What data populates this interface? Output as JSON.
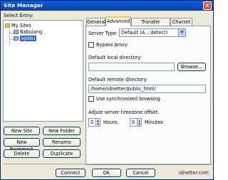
{
  "window": {
    "title": "Site Manager",
    "close_glyph": "×"
  },
  "left": {
    "select_entry_label": "Select Entry:",
    "tree": [
      {
        "label": "My Sites",
        "icon": "folder-icon"
      },
      {
        "label": "Babulang",
        "icon": "site-icon"
      },
      {
        "label": "vpsku",
        "icon": "site-icon",
        "selected": true
      }
    ],
    "buttons": {
      "new_site": "New Site",
      "new_folder": "New Folder",
      "new_bookmark": "New Bookmark",
      "rename": "Rename",
      "delete": "Delete",
      "duplicate": "Duplicate"
    }
  },
  "tabs": [
    "General",
    "Advanced",
    "Transfer Settings",
    "Charset"
  ],
  "active_tab": "Advanced",
  "advanced": {
    "server_type_label": "Server Type:",
    "server_type_value": "Default (A....detect)",
    "bypass_proxy_label": "Bypass proxy",
    "default_local_dir_label": "Default local directory:",
    "default_local_dir_value": "",
    "browse_label": "Browse...",
    "default_remote_dir_label": "Default remote directory:",
    "default_remote_dir_value": "/home/idnetter/public_html/",
    "sync_browsing_label": "Use synchronized browsing",
    "timezone_label": "Adjust server timezone offset:",
    "hours_value": "0",
    "hours_label": "Hours,",
    "minutes_value": "0",
    "minutes_label": "Minutes"
  },
  "bottom": {
    "connect": "Connect",
    "ok": "OK",
    "cancel": "Cancel",
    "watermark": "idnetter.com"
  }
}
